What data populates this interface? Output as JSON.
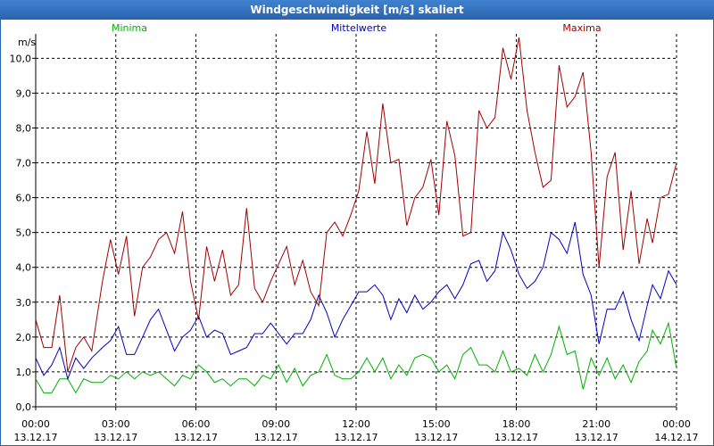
{
  "window_title": "Windgeschwindigkeit [m/s] skaliert",
  "chart_data": {
    "type": "line",
    "unit_label": "m/s",
    "ylim": [
      0,
      10.7
    ],
    "yticks": [
      "0,0",
      "1,0",
      "2,0",
      "3,0",
      "4,0",
      "5,0",
      "6,0",
      "7,0",
      "8,0",
      "9,0",
      "10,0"
    ],
    "xlim": [
      0,
      24
    ],
    "xticks": [
      {
        "time": "00:00",
        "date": "13.12.17"
      },
      {
        "time": "03:00",
        "date": "13.12.17"
      },
      {
        "time": "06:00",
        "date": "13.12.17"
      },
      {
        "time": "09:00",
        "date": "13.12.17"
      },
      {
        "time": "12:00",
        "date": "13.12.17"
      },
      {
        "time": "15:00",
        "date": "13.12.17"
      },
      {
        "time": "18:00",
        "date": "13.12.17"
      },
      {
        "time": "21:00",
        "date": "13.12.17"
      },
      {
        "time": "00:00",
        "date": "14.12.17"
      }
    ],
    "grid": true,
    "legend_position": "top",
    "series": [
      {
        "name": "Minima",
        "color": "#00b000",
        "points": [
          [
            0,
            0.8
          ],
          [
            0.3,
            0.4
          ],
          [
            0.6,
            0.4
          ],
          [
            0.9,
            0.8
          ],
          [
            1.2,
            0.8
          ],
          [
            1.5,
            0.4
          ],
          [
            1.8,
            0.8
          ],
          [
            2.1,
            0.7
          ],
          [
            2.5,
            0.7
          ],
          [
            2.8,
            0.9
          ],
          [
            3.1,
            0.8
          ],
          [
            3.4,
            1.0
          ],
          [
            3.7,
            0.8
          ],
          [
            4.0,
            1.0
          ],
          [
            4.3,
            0.9
          ],
          [
            4.6,
            1.0
          ],
          [
            4.9,
            0.8
          ],
          [
            5.2,
            0.6
          ],
          [
            5.5,
            0.9
          ],
          [
            5.8,
            0.8
          ],
          [
            6.1,
            1.2
          ],
          [
            6.4,
            1.0
          ],
          [
            6.7,
            0.7
          ],
          [
            7.0,
            0.8
          ],
          [
            7.3,
            0.6
          ],
          [
            7.6,
            0.8
          ],
          [
            7.9,
            0.8
          ],
          [
            8.2,
            0.6
          ],
          [
            8.5,
            0.9
          ],
          [
            8.8,
            0.8
          ],
          [
            9.1,
            1.2
          ],
          [
            9.4,
            0.7
          ],
          [
            9.7,
            1.1
          ],
          [
            10.0,
            0.6
          ],
          [
            10.3,
            0.9
          ],
          [
            10.6,
            1.0
          ],
          [
            10.9,
            1.5
          ],
          [
            11.2,
            0.9
          ],
          [
            11.5,
            0.8
          ],
          [
            11.8,
            0.8
          ],
          [
            12.1,
            1.0
          ],
          [
            12.4,
            1.4
          ],
          [
            12.7,
            1.0
          ],
          [
            13.0,
            1.4
          ],
          [
            13.3,
            0.8
          ],
          [
            13.6,
            1.2
          ],
          [
            13.9,
            0.9
          ],
          [
            14.2,
            1.4
          ],
          [
            14.5,
            1.5
          ],
          [
            14.8,
            1.4
          ],
          [
            15.1,
            1.0
          ],
          [
            15.4,
            1.2
          ],
          [
            15.7,
            0.8
          ],
          [
            16.0,
            1.5
          ],
          [
            16.3,
            1.7
          ],
          [
            16.6,
            1.2
          ],
          [
            16.9,
            1.2
          ],
          [
            17.2,
            1.0
          ],
          [
            17.5,
            1.6
          ],
          [
            17.8,
            1.0
          ],
          [
            18.1,
            1.1
          ],
          [
            18.4,
            0.9
          ],
          [
            18.7,
            1.5
          ],
          [
            19.0,
            1.0
          ],
          [
            19.3,
            1.5
          ],
          [
            19.6,
            2.3
          ],
          [
            19.9,
            1.5
          ],
          [
            20.2,
            1.6
          ],
          [
            20.5,
            0.5
          ],
          [
            20.8,
            1.4
          ],
          [
            21.1,
            0.9
          ],
          [
            21.4,
            1.4
          ],
          [
            21.7,
            0.8
          ],
          [
            22.0,
            1.2
          ],
          [
            22.3,
            0.7
          ],
          [
            22.6,
            1.3
          ],
          [
            22.9,
            1.6
          ],
          [
            23.1,
            2.2
          ],
          [
            23.4,
            1.8
          ],
          [
            23.7,
            2.4
          ],
          [
            24.0,
            1.1
          ]
        ]
      },
      {
        "name": "Mittelwerte",
        "color": "#0000c0",
        "points": [
          [
            0,
            1.4
          ],
          [
            0.3,
            0.9
          ],
          [
            0.6,
            1.2
          ],
          [
            0.9,
            1.7
          ],
          [
            1.2,
            0.8
          ],
          [
            1.5,
            1.4
          ],
          [
            1.8,
            1.1
          ],
          [
            2.1,
            1.4
          ],
          [
            2.5,
            1.7
          ],
          [
            2.8,
            1.9
          ],
          [
            3.1,
            2.3
          ],
          [
            3.4,
            1.5
          ],
          [
            3.7,
            1.5
          ],
          [
            4.0,
            2.0
          ],
          [
            4.3,
            2.5
          ],
          [
            4.6,
            2.8
          ],
          [
            4.9,
            2.2
          ],
          [
            5.2,
            1.6
          ],
          [
            5.5,
            2.0
          ],
          [
            5.8,
            2.2
          ],
          [
            6.1,
            2.6
          ],
          [
            6.4,
            2.0
          ],
          [
            6.7,
            2.2
          ],
          [
            7.0,
            2.1
          ],
          [
            7.3,
            1.5
          ],
          [
            7.6,
            1.6
          ],
          [
            7.9,
            1.7
          ],
          [
            8.2,
            2.1
          ],
          [
            8.5,
            2.1
          ],
          [
            8.8,
            2.4
          ],
          [
            9.1,
            2.1
          ],
          [
            9.4,
            1.8
          ],
          [
            9.7,
            2.1
          ],
          [
            10.0,
            2.1
          ],
          [
            10.3,
            2.5
          ],
          [
            10.6,
            3.2
          ],
          [
            10.9,
            2.7
          ],
          [
            11.2,
            2.0
          ],
          [
            11.5,
            2.5
          ],
          [
            11.8,
            2.9
          ],
          [
            12.1,
            3.3
          ],
          [
            12.4,
            3.3
          ],
          [
            12.7,
            3.5
          ],
          [
            13.0,
            3.2
          ],
          [
            13.3,
            2.5
          ],
          [
            13.6,
            3.1
          ],
          [
            13.9,
            2.7
          ],
          [
            14.2,
            3.2
          ],
          [
            14.5,
            2.8
          ],
          [
            14.8,
            3.0
          ],
          [
            15.1,
            3.3
          ],
          [
            15.4,
            3.5
          ],
          [
            15.7,
            3.1
          ],
          [
            16.0,
            3.5
          ],
          [
            16.3,
            4.1
          ],
          [
            16.6,
            4.2
          ],
          [
            16.9,
            3.6
          ],
          [
            17.2,
            3.9
          ],
          [
            17.5,
            5.0
          ],
          [
            17.8,
            4.5
          ],
          [
            18.1,
            3.8
          ],
          [
            18.4,
            3.4
          ],
          [
            18.7,
            3.6
          ],
          [
            19.0,
            4.0
          ],
          [
            19.3,
            5.0
          ],
          [
            19.6,
            4.8
          ],
          [
            19.9,
            4.4
          ],
          [
            20.2,
            5.3
          ],
          [
            20.5,
            3.8
          ],
          [
            20.8,
            3.2
          ],
          [
            21.1,
            1.8
          ],
          [
            21.4,
            2.8
          ],
          [
            21.7,
            2.8
          ],
          [
            22.0,
            3.3
          ],
          [
            22.3,
            2.5
          ],
          [
            22.6,
            1.9
          ],
          [
            22.9,
            2.9
          ],
          [
            23.1,
            3.5
          ],
          [
            23.4,
            3.1
          ],
          [
            23.7,
            3.9
          ],
          [
            24.0,
            3.5
          ]
        ]
      },
      {
        "name": "Maxima",
        "color": "#a00000",
        "points": [
          [
            0,
            2.5
          ],
          [
            0.3,
            1.7
          ],
          [
            0.6,
            1.7
          ],
          [
            0.9,
            3.2
          ],
          [
            1.2,
            1.0
          ],
          [
            1.5,
            1.7
          ],
          [
            1.8,
            2.0
          ],
          [
            2.1,
            1.6
          ],
          [
            2.5,
            3.6
          ],
          [
            2.8,
            4.8
          ],
          [
            3.1,
            3.8
          ],
          [
            3.4,
            4.9
          ],
          [
            3.7,
            2.6
          ],
          [
            4.0,
            4.0
          ],
          [
            4.3,
            4.3
          ],
          [
            4.6,
            4.8
          ],
          [
            4.9,
            5.0
          ],
          [
            5.2,
            4.4
          ],
          [
            5.5,
            5.6
          ],
          [
            5.8,
            3.6
          ],
          [
            6.1,
            2.5
          ],
          [
            6.4,
            4.6
          ],
          [
            6.7,
            3.6
          ],
          [
            7.0,
            4.5
          ],
          [
            7.3,
            3.2
          ],
          [
            7.6,
            3.5
          ],
          [
            7.9,
            5.7
          ],
          [
            8.2,
            3.4
          ],
          [
            8.5,
            3.0
          ],
          [
            8.8,
            3.6
          ],
          [
            9.1,
            4.1
          ],
          [
            9.4,
            4.6
          ],
          [
            9.7,
            3.5
          ],
          [
            10.0,
            4.2
          ],
          [
            10.3,
            3.3
          ],
          [
            10.6,
            2.9
          ],
          [
            10.9,
            5.0
          ],
          [
            11.2,
            5.3
          ],
          [
            11.5,
            4.9
          ],
          [
            11.8,
            5.5
          ],
          [
            12.1,
            6.2
          ],
          [
            12.4,
            7.9
          ],
          [
            12.7,
            6.4
          ],
          [
            13.0,
            8.7
          ],
          [
            13.3,
            7.0
          ],
          [
            13.6,
            7.1
          ],
          [
            13.9,
            5.2
          ],
          [
            14.2,
            6.0
          ],
          [
            14.5,
            6.3
          ],
          [
            14.8,
            7.1
          ],
          [
            15.1,
            5.5
          ],
          [
            15.4,
            8.2
          ],
          [
            15.7,
            7.2
          ],
          [
            16.0,
            4.9
          ],
          [
            16.3,
            5.0
          ],
          [
            16.6,
            8.5
          ],
          [
            16.9,
            8.0
          ],
          [
            17.2,
            8.3
          ],
          [
            17.5,
            10.3
          ],
          [
            17.8,
            9.4
          ],
          [
            18.1,
            10.6
          ],
          [
            18.4,
            8.5
          ],
          [
            18.7,
            7.3
          ],
          [
            19.0,
            6.3
          ],
          [
            19.3,
            6.5
          ],
          [
            19.6,
            9.8
          ],
          [
            19.9,
            8.6
          ],
          [
            20.2,
            8.9
          ],
          [
            20.5,
            9.6
          ],
          [
            20.8,
            7.3
          ],
          [
            21.1,
            4.0
          ],
          [
            21.4,
            6.6
          ],
          [
            21.7,
            7.3
          ],
          [
            22.0,
            4.5
          ],
          [
            22.3,
            6.2
          ],
          [
            22.6,
            4.1
          ],
          [
            22.9,
            5.4
          ],
          [
            23.1,
            4.7
          ],
          [
            23.4,
            6.0
          ],
          [
            23.7,
            6.1
          ],
          [
            24.0,
            7.0
          ]
        ]
      }
    ]
  }
}
